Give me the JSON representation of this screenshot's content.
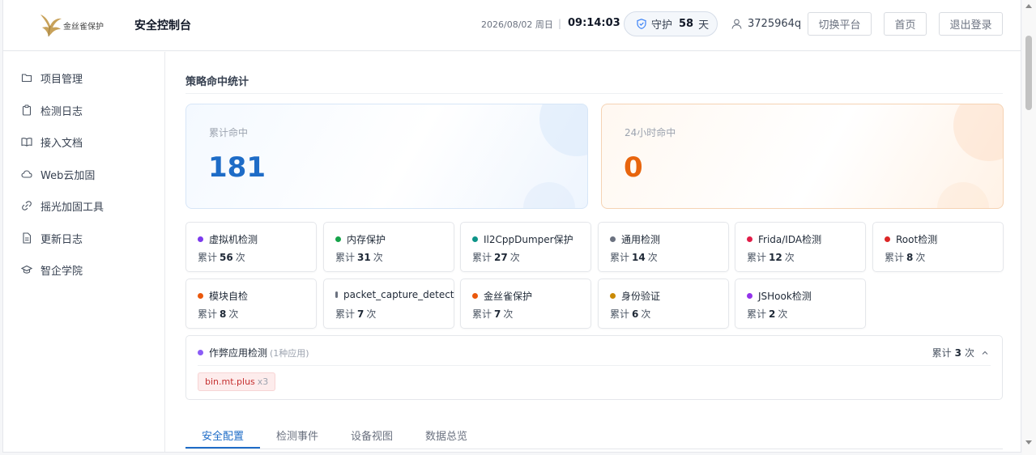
{
  "header": {
    "logo_text": "金丝雀保护",
    "app_title": "安全控制台",
    "date": "2026/08/02 周日",
    "separator": "|",
    "time": "09:14:03",
    "guard_label": "守护",
    "guard_days": "58",
    "guard_unit": "天",
    "username": "3725964q",
    "switch_platform": "切换平台",
    "home": "首页",
    "logout": "退出登录"
  },
  "sidebar": {
    "items": [
      {
        "label": "项目管理",
        "icon": "folder-icon"
      },
      {
        "label": "检测日志",
        "icon": "clipboard-icon"
      },
      {
        "label": "接入文档",
        "icon": "book-icon"
      },
      {
        "label": "Web云加固",
        "icon": "cloud-icon"
      },
      {
        "label": "摇光加固工具",
        "icon": "link-icon"
      },
      {
        "label": "更新日志",
        "icon": "document-icon"
      },
      {
        "label": "智企学院",
        "icon": "graduation-cap-icon"
      }
    ]
  },
  "main": {
    "section_title": "策略命中统计",
    "total": {
      "label": "累计命中",
      "value": "181"
    },
    "day": {
      "label": "24小时命中",
      "value": "0"
    },
    "count_prefix": "累计",
    "count_suffix": "次",
    "stats": [
      {
        "name": "虚拟机检测",
        "count": "56",
        "color": "#7c3aed"
      },
      {
        "name": "内存保护",
        "count": "31",
        "color": "#16a34a"
      },
      {
        "name": "Il2CppDumper保护",
        "count": "27",
        "color": "#0d9488"
      },
      {
        "name": "通用检测",
        "count": "14",
        "color": "#6b7280"
      },
      {
        "name": "Frida/IDA检测",
        "count": "12",
        "color": "#e11d48"
      },
      {
        "name": "Root检测",
        "count": "8",
        "color": "#dc2626"
      },
      {
        "name": "模块自检",
        "count": "8",
        "color": "#ea580c"
      },
      {
        "name": "packet_capture_detect",
        "count": "7",
        "color": "#6b7280"
      },
      {
        "name": "金丝雀保护",
        "count": "7",
        "color": "#ea580c"
      },
      {
        "name": "身份验证",
        "count": "6",
        "color": "#ca8a04"
      },
      {
        "name": "JSHook检测",
        "count": "2",
        "color": "#9333ea"
      }
    ],
    "cheat": {
      "name": "作弊应用检测",
      "sub": "(1种应用)",
      "count_prefix": "累计",
      "count": "3",
      "count_suffix": "次",
      "color": "#8b5cf6",
      "chip_label": "bin.mt.plus",
      "chip_count": "x3"
    },
    "tabs": [
      "安全配置",
      "检测事件",
      "设备视图",
      "数据总览"
    ],
    "active_tab": "安全配置"
  },
  "colors": {
    "accent": "#1e6cc7",
    "total_number": "#1e6cc7",
    "day_number": "#e8650d"
  }
}
